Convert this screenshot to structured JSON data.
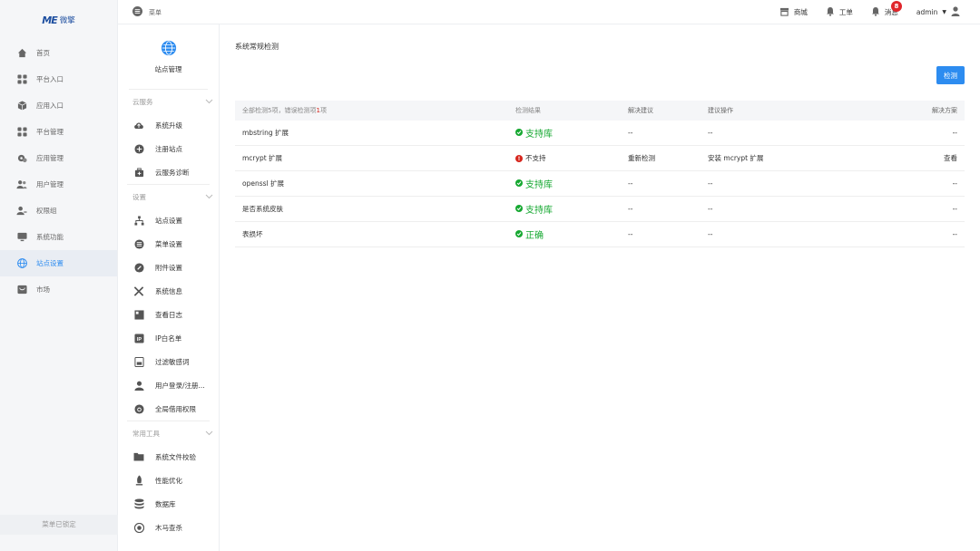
{
  "logo": {
    "mark": "ME",
    "text": "微擎"
  },
  "sidebar": {
    "items": [
      {
        "label": "首页",
        "icon": "home-icon"
      },
      {
        "label": "平台入口",
        "icon": "grid-icon"
      },
      {
        "label": "应用入口",
        "icon": "cube-icon"
      },
      {
        "label": "平台管理",
        "icon": "grid-icon"
      },
      {
        "label": "应用管理",
        "icon": "app-gear-icon"
      },
      {
        "label": "用户管理",
        "icon": "users-icon"
      },
      {
        "label": "权限组",
        "icon": "user-key-icon"
      },
      {
        "label": "系统功能",
        "icon": "monitor-icon"
      },
      {
        "label": "站点设置",
        "icon": "globe-icon",
        "active": true
      },
      {
        "label": "市场",
        "icon": "store-icon"
      }
    ],
    "lock_label": "菜单已锁定"
  },
  "topbar": {
    "menu_label": "菜单",
    "mall_label": "商城",
    "ticket_label": "工单",
    "message_label": "消息",
    "message_badge": "8",
    "user_label": "admin"
  },
  "subnav": {
    "title": "站点管理",
    "groups": [
      {
        "title": "云服务",
        "items": [
          "系统升级",
          "注册站点",
          "云服务诊断"
        ]
      },
      {
        "title": "设置",
        "items": [
          "站点设置",
          "菜单设置",
          "附件设置",
          "系统信息",
          "查看日志",
          "IP白名单",
          "过滤敏感词",
          "用户登录/注册...",
          "全局借用权限"
        ]
      },
      {
        "title": "常用工具",
        "items": [
          "系统文件校验",
          "性能优化",
          "数据库",
          "木马查杀"
        ]
      }
    ]
  },
  "main": {
    "title": "系统常规检测",
    "check_button": "检测",
    "table": {
      "summary_prefix": "全部检测5项，错误检测项",
      "summary_errors": "1",
      "summary_suffix": "项",
      "headers": [
        "检测结果",
        "解决建议",
        "建议操作",
        "解决方案"
      ],
      "rows": [
        {
          "name": "mbstring 扩展",
          "status": "ok",
          "result": "支持库",
          "advice": "--",
          "action": "--",
          "solution": "--"
        },
        {
          "name": "mcrypt 扩展",
          "status": "error",
          "result": "不支持",
          "advice": "重新检测",
          "action": "安装 mcrypt 扩展",
          "solution": "查看"
        },
        {
          "name": "openssl 扩展",
          "status": "ok",
          "result": "支持库",
          "advice": "--",
          "action": "--",
          "solution": "--"
        },
        {
          "name": "是否系统皮肤",
          "status": "ok",
          "result": "支持库",
          "advice": "--",
          "action": "--",
          "solution": "--"
        },
        {
          "name": "表损坏",
          "status": "ok",
          "result": "正确",
          "advice": "--",
          "action": "--",
          "solution": "--"
        }
      ]
    }
  },
  "colors": {
    "accent": "#2d8cf0",
    "success": "#16a831",
    "error": "#d6261d",
    "badge": "#e0262b"
  }
}
